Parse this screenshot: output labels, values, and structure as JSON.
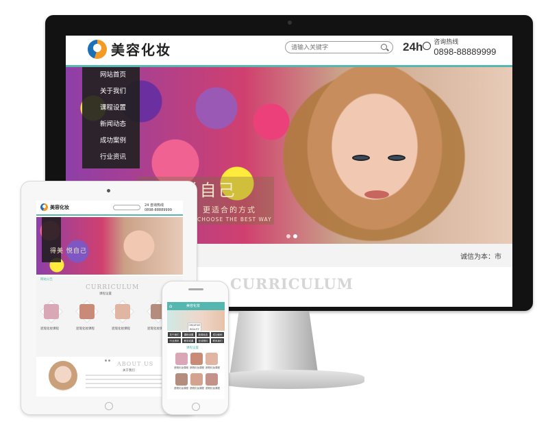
{
  "desktop": {
    "logo_text": "美容化妆",
    "search_placeholder": "请输入关键字",
    "hotline_badge": "24h",
    "hotline_label": "咨询热线",
    "hotline_number": "0898-88889999",
    "menu": [
      "网站首页",
      "关于我们",
      "课程设置",
      "新闻动态",
      "成功案例",
      "行业资讯"
    ],
    "slogan_main": "得美 悦自己",
    "slogan_sub": "更适合的方式",
    "slogan_en": "CHOOSE THE BEST WAY",
    "notice_text": "诚信为本：市",
    "section_title": "CURRICULUM"
  },
  "tablet": {
    "logo_text": "美容化妆",
    "hotline_badge": "24",
    "hotline_label": "咨询热线",
    "hotline_number": "0898-88889999",
    "slogan": "得美 悦自己",
    "notice": "网站公告",
    "section_title": "CURRICULUM",
    "section_subtitle": "课程设置",
    "courses": [
      "遮瑕化妆课程",
      "遮瑕化妆课程",
      "遮瑕化妆课程",
      "遮瑕化妆课程"
    ],
    "about_title": "ABOUT US",
    "about_subtitle": "关于我们"
  },
  "phone": {
    "logo_text": "美容化妆",
    "banner_tag": "CREATIVE BEAUTY",
    "nav": [
      "关于我们",
      "课程设置",
      "新闻动态",
      "成功案例",
      "行业资讯",
      "教学成果",
      "在线预约",
      "联系我们"
    ],
    "section_title": "课程设置",
    "courses": [
      "遮瑕化妆课程",
      "遮瑕化妆课程",
      "遮瑕化妆课程",
      "遮瑕化妆课程",
      "遮瑕化妆课程",
      "遮瑕化妆课程"
    ]
  },
  "colors": {
    "accent": "#56b7b0",
    "menu_bg": "#202020",
    "logo_orange": "#f29a24",
    "logo_blue": "#1d6fb8"
  },
  "icons": [
    "logo-icon",
    "search-icon",
    "clock-icon",
    "home-icon",
    "camera-icon",
    "home-button-icon"
  ]
}
